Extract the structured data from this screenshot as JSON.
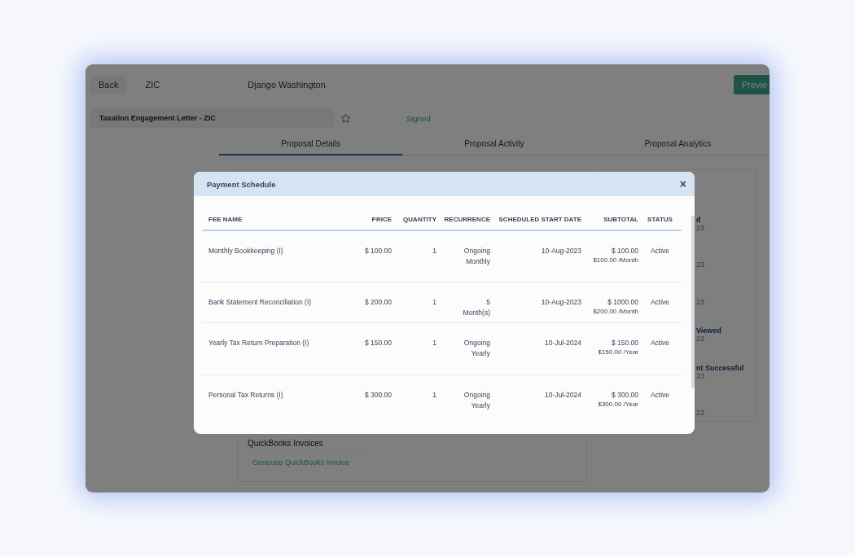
{
  "header": {
    "back_button": "Back",
    "client": "ZIC",
    "contact": "Django Washington",
    "preview_button": "Previe"
  },
  "proposal": {
    "title": "Taxation Engagement Letter - ZIC",
    "starred": false,
    "status": "Signed"
  },
  "tabs": [
    {
      "label": "Proposal Details",
      "selected": true
    },
    {
      "label": "Proposal Activity",
      "selected": false
    },
    {
      "label": "Proposal Analytics",
      "selected": false
    }
  ],
  "activity": [
    {
      "title": "d",
      "date": "23"
    },
    {
      "date": "23"
    },
    {
      "date": "23"
    },
    {
      "title": "Viewed",
      "date": "23"
    },
    {
      "title": "nt Successful",
      "date": "23"
    },
    {
      "date": "23"
    }
  ],
  "quickbooks": {
    "heading": "QuickBooks Invoices",
    "link": "Generate QuickBooks Invoice"
  },
  "modal": {
    "title": "Payment Schedule",
    "close": "×",
    "columns": [
      "FEE NAME",
      "PRICE",
      "QUANTITY",
      "RECURRENCE",
      "SCHEDULED START DATE",
      "SUBTOTAL",
      "STATUS"
    ],
    "rows": [
      {
        "fee_name": "Monthly Bookkeeping (I)",
        "price": "$ 100.00",
        "quantity": "1",
        "recurrence": "Ongoing Monthly",
        "start_date": "10-Aug-2023",
        "subtotal": "$ 100.00",
        "rate": "$100.00 /Month",
        "status": "Active"
      },
      {
        "fee_name": "Bank Statement Reconciliation (I)",
        "price": "$ 200.00",
        "quantity": "1",
        "recurrence": "5 Month(s)",
        "start_date": "10-Aug-2023",
        "subtotal": "$ 1000.00",
        "rate": "$200.00 /Month",
        "status": "Active"
      },
      {
        "fee_name": "Yearly Tax Return Preparation (I)",
        "price": "$ 150.00",
        "quantity": "1",
        "recurrence": "Ongoing Yearly",
        "start_date": "10-Jul-2024",
        "subtotal": "$ 150.00",
        "rate": "$150.00 /Year",
        "status": "Active"
      },
      {
        "fee_name": "Personal Tax Returns (I)",
        "price": "$ 300.00",
        "quantity": "1",
        "recurrence": "Ongoing Yearly",
        "start_date": "10-Jul-2024",
        "subtotal": "$ 300.00",
        "rate": "$300.00 /Year",
        "status": "Active"
      }
    ]
  }
}
